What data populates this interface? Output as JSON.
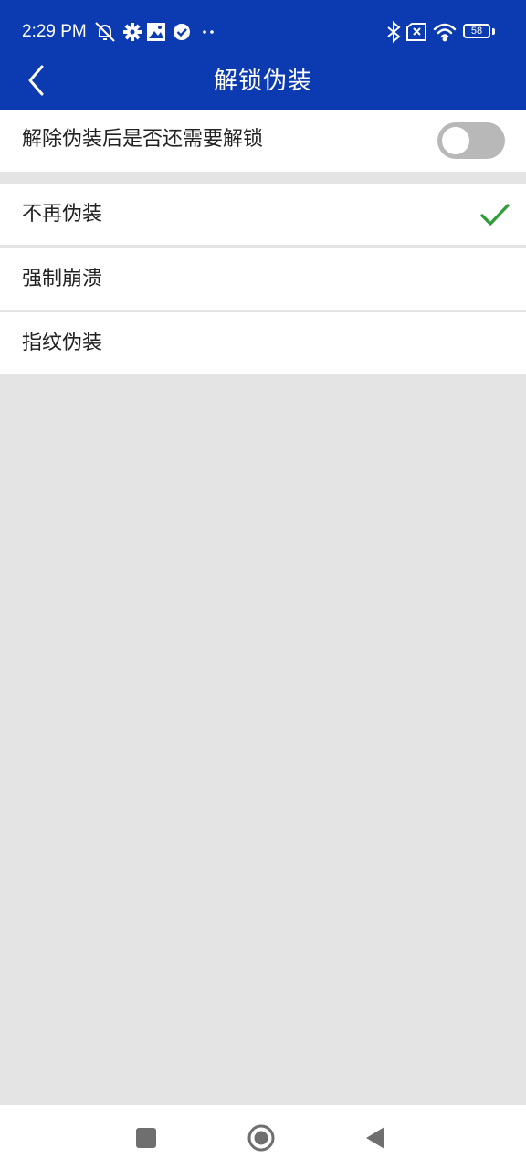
{
  "status_bar": {
    "time": "2:29 PM",
    "battery_level": "58",
    "left_icons": [
      "alarm-off-icon",
      "gear-icon",
      "gallery-icon",
      "check-circle-icon",
      "more-dots-icon"
    ],
    "right_icons": [
      "bluetooth-icon",
      "no-sim-icon",
      "wifi-icon",
      "battery-icon"
    ]
  },
  "app_bar": {
    "title": "解锁伪装",
    "back_icon": "chevron-left-icon"
  },
  "settings": {
    "unlock_toggle": {
      "label": "解除伪装后是否还需要解锁",
      "enabled": false
    }
  },
  "disguise_options": [
    {
      "label": "不再伪装",
      "selected": true
    },
    {
      "label": "强制崩溃",
      "selected": false
    },
    {
      "label": "指纹伪装",
      "selected": false
    }
  ],
  "colors": {
    "primary": "#0c3ab0",
    "check": "#2e9e3a",
    "background": "#e4e4e4",
    "toggle_off": "#b8b8b8"
  },
  "nav_bar": {
    "buttons": [
      "recents-square-icon",
      "home-circle-icon",
      "back-triangle-icon"
    ]
  }
}
